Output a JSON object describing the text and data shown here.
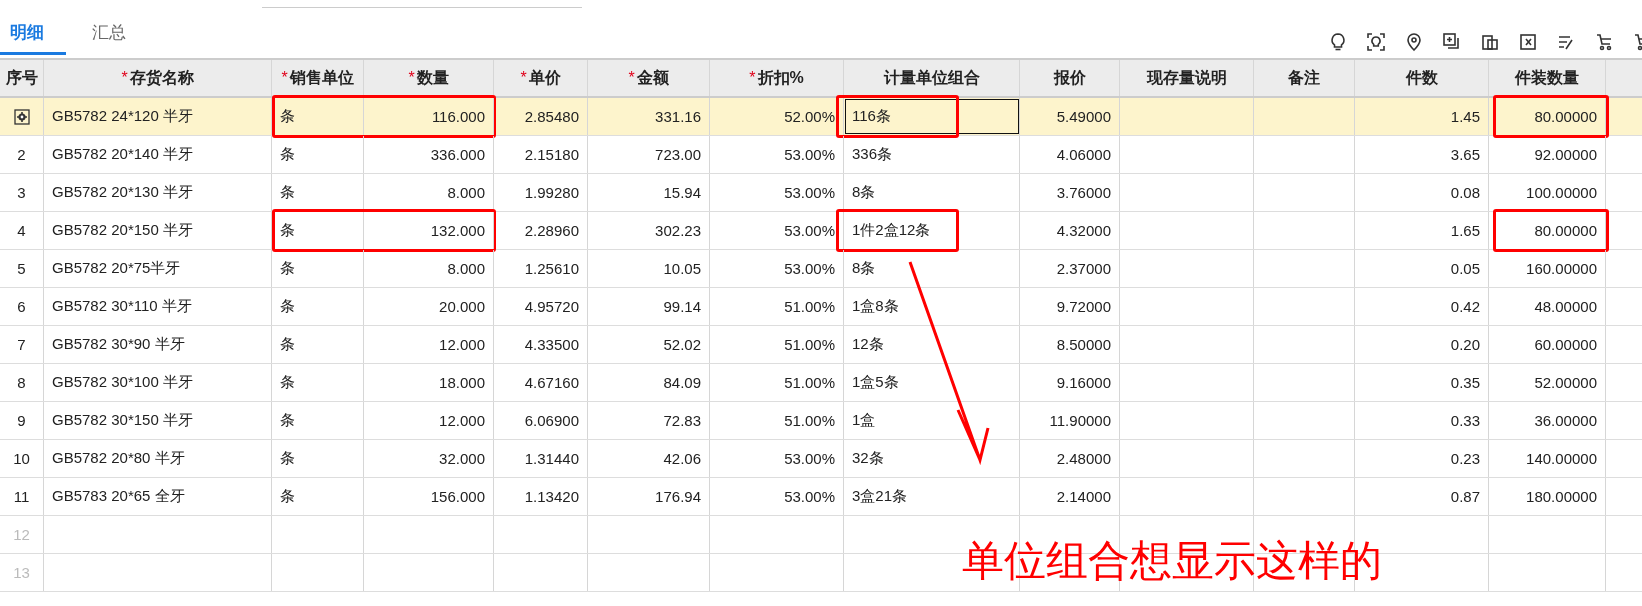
{
  "tabs": [
    {
      "label": "明细",
      "selected": true
    },
    {
      "label": "汇总",
      "selected": false
    }
  ],
  "columns": [
    {
      "label": "序号",
      "kind": "index"
    },
    {
      "label": "存货名称",
      "mark": "*",
      "kind": "text"
    },
    {
      "label": "销售单位",
      "mark": "*",
      "kind": "text"
    },
    {
      "label": "数量",
      "mark": "*",
      "kind": "number"
    },
    {
      "label": "单价",
      "mark": "*",
      "kind": "number"
    },
    {
      "label": "金额",
      "mark": "*",
      "kind": "number"
    },
    {
      "label": "折扣%",
      "mark": "*",
      "kind": "number"
    },
    {
      "label": "计量单位组合",
      "kind": "text"
    },
    {
      "label": "报价",
      "kind": "number"
    },
    {
      "label": "现存量说明",
      "kind": "text"
    },
    {
      "label": "备注",
      "kind": "text"
    },
    {
      "label": "件数",
      "kind": "number"
    },
    {
      "label": "件装数量",
      "kind": "number"
    }
  ],
  "rows": [
    {
      "selected": true,
      "marked": true,
      "cells": [
        "",
        "GB5782 24*120 半牙",
        "条",
        "116.000",
        "2.85480",
        "331.16",
        "52.00%",
        {
          "text": "116条",
          "active": true
        },
        "5.49000",
        "",
        "",
        "1.45",
        "80.00000"
      ]
    },
    {
      "selected": false,
      "marked": false,
      "cells": [
        "2",
        "GB5782 20*140 半牙",
        "条",
        "336.000",
        "2.15180",
        "723.00",
        "53.00%",
        "336条",
        "4.06000",
        "",
        "",
        "3.65",
        "92.00000"
      ]
    },
    {
      "selected": false,
      "marked": false,
      "cells": [
        "3",
        "GB5782 20*130 半牙",
        "条",
        "8.000",
        "1.99280",
        "15.94",
        "53.00%",
        "8条",
        "3.76000",
        "",
        "",
        "0.08",
        "100.00000"
      ]
    },
    {
      "selected": false,
      "marked": true,
      "cells": [
        "4",
        "GB5782 20*150 半牙",
        "条",
        "132.000",
        "2.28960",
        "302.23",
        "53.00%",
        "1件2盒12条",
        "4.32000",
        "",
        "",
        "1.65",
        "80.00000"
      ]
    },
    {
      "selected": false,
      "marked": false,
      "cells": [
        "5",
        "GB5782 20*75半牙",
        "条",
        "8.000",
        "1.25610",
        "10.05",
        "53.00%",
        "8条",
        "2.37000",
        "",
        "",
        "0.05",
        "160.00000"
      ]
    },
    {
      "selected": false,
      "marked": false,
      "cells": [
        "6",
        "GB5782 30*110 半牙",
        "条",
        "20.000",
        "4.95720",
        "99.14",
        "51.00%",
        "1盒8条",
        "9.72000",
        "",
        "",
        "0.42",
        "48.00000"
      ]
    },
    {
      "selected": false,
      "marked": false,
      "cells": [
        "7",
        "GB5782 30*90 半牙",
        "条",
        "12.000",
        "4.33500",
        "52.02",
        "51.00%",
        "12条",
        "8.50000",
        "",
        "",
        "0.20",
        "60.00000"
      ]
    },
    {
      "selected": false,
      "marked": false,
      "cells": [
        "8",
        "GB5782 30*100 半牙",
        "条",
        "18.000",
        "4.67160",
        "84.09",
        "51.00%",
        "1盒5条",
        "9.16000",
        "",
        "",
        "0.35",
        "52.00000"
      ]
    },
    {
      "selected": false,
      "marked": false,
      "cells": [
        "9",
        "GB5782 30*150 半牙",
        "条",
        "12.000",
        "6.06900",
        "72.83",
        "51.00%",
        "1盒",
        "11.90000",
        "",
        "",
        "0.33",
        "36.00000"
      ]
    },
    {
      "selected": false,
      "marked": false,
      "cells": [
        "10",
        "GB5782 20*80 半牙",
        "条",
        "32.000",
        "1.31440",
        "42.06",
        "53.00%",
        "32条",
        "2.48000",
        "",
        "",
        "0.23",
        "140.00000"
      ]
    },
    {
      "selected": false,
      "marked": false,
      "cells": [
        "11",
        "GB5783 20*65 全牙",
        "条",
        "156.000",
        "1.13420",
        "176.94",
        "53.00%",
        "3盒21条",
        "2.14000",
        "",
        "",
        "0.87",
        "180.00000"
      ]
    },
    {
      "selected": false,
      "marked": false,
      "cells": [
        "12"
      ]
    },
    {
      "selected": false,
      "marked": false,
      "cells": [
        "13"
      ]
    }
  ],
  "annotation_note": "单位组合想显示这样的"
}
